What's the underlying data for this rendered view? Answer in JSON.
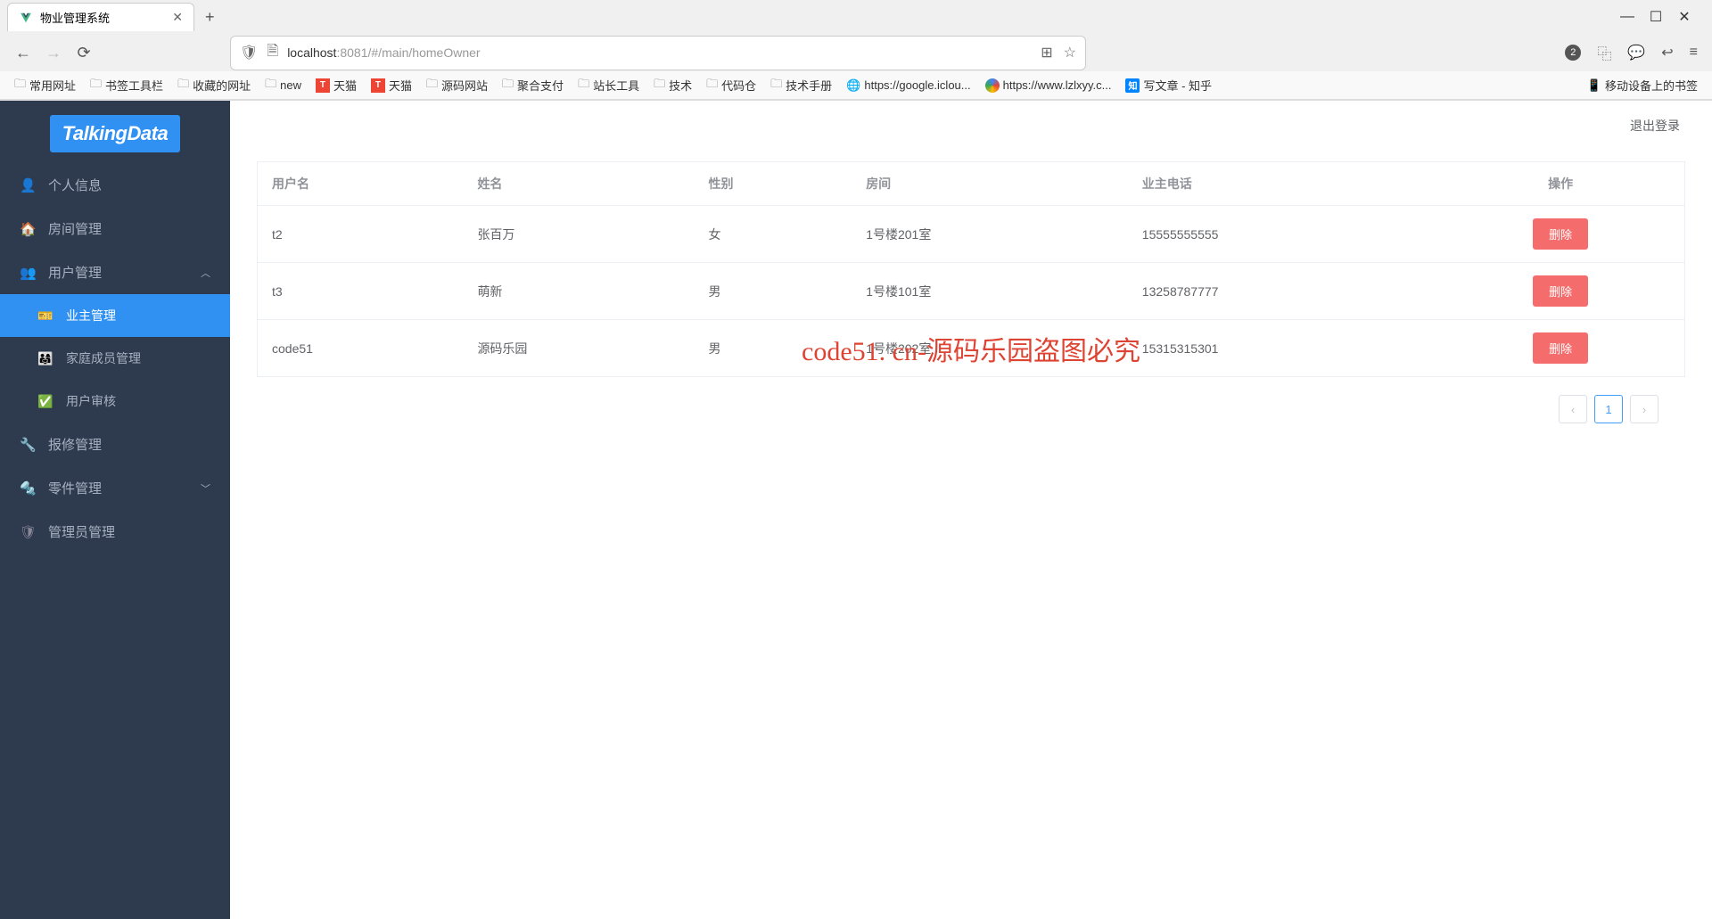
{
  "browser": {
    "tab_title": "物业管理系统",
    "url_host": "localhost",
    "url_port": ":8081",
    "url_path": "/#/main/homeOwner",
    "notif_count": "2",
    "bookmarks": [
      {
        "type": "folder",
        "label": "常用网址"
      },
      {
        "type": "folder",
        "label": "书签工具栏"
      },
      {
        "type": "folder",
        "label": "收藏的网址"
      },
      {
        "type": "folder",
        "label": "new"
      },
      {
        "type": "tmall",
        "label": "天猫"
      },
      {
        "type": "tmall",
        "label": "天猫"
      },
      {
        "type": "folder",
        "label": "源码网站"
      },
      {
        "type": "folder",
        "label": "聚合支付"
      },
      {
        "type": "folder",
        "label": "站长工具"
      },
      {
        "type": "folder",
        "label": "技术"
      },
      {
        "type": "folder",
        "label": "代码仓"
      },
      {
        "type": "folder",
        "label": "技术手册"
      },
      {
        "type": "globe",
        "label": "https://google.iclou..."
      },
      {
        "type": "color",
        "label": "https://www.lzlxyy.c..."
      },
      {
        "type": "zhi",
        "label": "写文章 - 知乎"
      }
    ],
    "bookmark_right": "移动设备上的书签"
  },
  "sidebar": {
    "logo": "TalkingData",
    "items": [
      {
        "icon": "person",
        "label": "个人信息",
        "expandable": false
      },
      {
        "icon": "home",
        "label": "房间管理",
        "expandable": false
      },
      {
        "icon": "users",
        "label": "用户管理",
        "expandable": true,
        "expanded": true,
        "children": [
          {
            "icon": "badge",
            "label": "业主管理",
            "active": true
          },
          {
            "icon": "family",
            "label": "家庭成员管理"
          },
          {
            "icon": "audit",
            "label": "用户审核"
          }
        ]
      },
      {
        "icon": "wrench",
        "label": "报修管理",
        "expandable": false
      },
      {
        "icon": "tool",
        "label": "零件管理",
        "expandable": true,
        "expanded": false
      },
      {
        "icon": "admin",
        "label": "管理员管理",
        "expandable": false
      }
    ]
  },
  "header": {
    "logout": "退出登录"
  },
  "table": {
    "columns": [
      "用户名",
      "姓名",
      "性别",
      "房间",
      "业主电话",
      "操作"
    ],
    "rows": [
      {
        "username": "t2",
        "name": "张百万",
        "gender": "女",
        "room": "1号楼201室",
        "phone": "15555555555"
      },
      {
        "username": "t3",
        "name": "萌新",
        "gender": "男",
        "room": "1号楼101室",
        "phone": "13258787777"
      },
      {
        "username": "code51",
        "name": "源码乐园",
        "gender": "男",
        "room": "1号楼202室",
        "phone": "15315315301"
      }
    ],
    "delete_label": "删除"
  },
  "watermark": "code51. cn-源码乐园盗图必究",
  "pagination": {
    "current": "1"
  }
}
